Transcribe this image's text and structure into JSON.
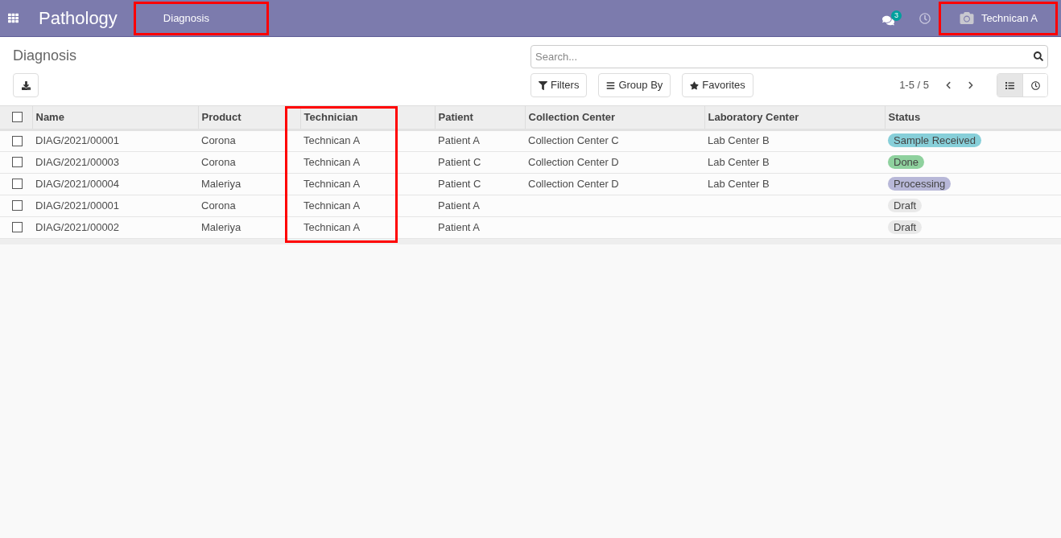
{
  "navbar": {
    "app_title": "Pathology",
    "menu": [
      {
        "label": "Diagnosis",
        "highlighted": true
      }
    ],
    "messages_badge": "3",
    "user": {
      "name": "Technican A",
      "highlighted": true
    }
  },
  "control_panel": {
    "breadcrumb": "Diagnosis",
    "search": {
      "placeholder": "Search..."
    },
    "filters": [
      "Filters",
      "Group By",
      "Favorites"
    ],
    "pager": "1-5 / 5",
    "views": [
      {
        "kind": "list",
        "selected": true
      },
      {
        "kind": "activity",
        "selected": false
      }
    ]
  },
  "table": {
    "select_all": {
      "checked": false
    },
    "columns": [
      {
        "label": "Name",
        "highlighted": false
      },
      {
        "label": "Product",
        "highlighted": false
      },
      {
        "label": "Technician",
        "highlighted": true
      },
      {
        "label": "Patient",
        "highlighted": false
      },
      {
        "label": "Collection Center",
        "highlighted": false
      },
      {
        "label": "Laboratory Center",
        "highlighted": false
      },
      {
        "label": "Status",
        "highlighted": false
      }
    ],
    "rows": [
      {
        "checked": false,
        "cells": [
          "DIAG/2021/00001",
          "Corona",
          "Technican A",
          "Patient A",
          "Collection Center C",
          "Lab Center B"
        ],
        "status": {
          "label": "Sample Received",
          "color": "#87cfd9"
        }
      },
      {
        "checked": false,
        "cells": [
          "DIAG/2021/00003",
          "Corona",
          "Technican A",
          "Patient C",
          "Collection Center D",
          "Lab Center B"
        ],
        "status": {
          "label": "Done",
          "color": "#8fd19e"
        }
      },
      {
        "checked": false,
        "cells": [
          "DIAG/2021/00004",
          "Maleriya",
          "Technican A",
          "Patient C",
          "Collection Center D",
          "Lab Center B"
        ],
        "status": {
          "label": "Processing",
          "color": "#b8b8d8"
        }
      },
      {
        "checked": false,
        "cells": [
          "DIAG/2021/00001",
          "Corona",
          "Technican A",
          "Patient A",
          "",
          ""
        ],
        "status": {
          "label": "Draft",
          "color": "#e9e9e9"
        }
      },
      {
        "checked": false,
        "cells": [
          "DIAG/2021/00002",
          "Maleriya",
          "Technican A",
          "Patient A",
          "",
          ""
        ],
        "status": {
          "label": "Draft",
          "color": "#e9e9e9"
        }
      }
    ]
  }
}
